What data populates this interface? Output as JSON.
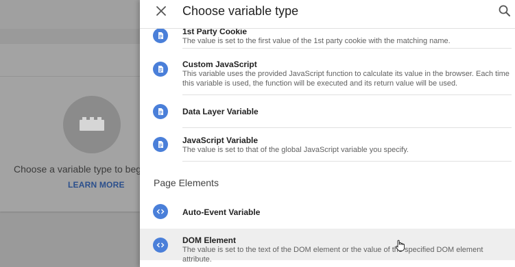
{
  "background": {
    "empty_text": "Choose a variable type to begin",
    "learn_more": "LEARN MORE"
  },
  "panel": {
    "title": "Choose variable type",
    "close_icon": "close-icon",
    "search_icon": "search-icon"
  },
  "items": [
    {
      "name": "1st Party Cookie",
      "desc": "The value is set to the first value of the 1st party cookie with the matching name.",
      "icon": "document-icon"
    },
    {
      "name": "Custom JavaScript",
      "desc": "This variable uses the provided JavaScript function to calculate its value in the browser. Each time this variable is used, the function will be executed and its return value will be used.",
      "icon": "document-icon"
    },
    {
      "name": "Data Layer Variable",
      "desc": "",
      "icon": "document-icon"
    },
    {
      "name": "JavaScript Variable",
      "desc": "The value is set to that of the global JavaScript variable you specify.",
      "icon": "document-icon"
    }
  ],
  "section": {
    "label": "Page Elements"
  },
  "page_items": [
    {
      "name": "Auto-Event Variable",
      "desc": "",
      "icon": "code-icon"
    },
    {
      "name": "DOM Element",
      "desc": "The value is set to the text of the DOM element or the value of the specified DOM element attribute.",
      "icon": "code-icon"
    }
  ],
  "colors": {
    "accent": "#4a7fd9",
    "link": "#2b4f8c"
  }
}
